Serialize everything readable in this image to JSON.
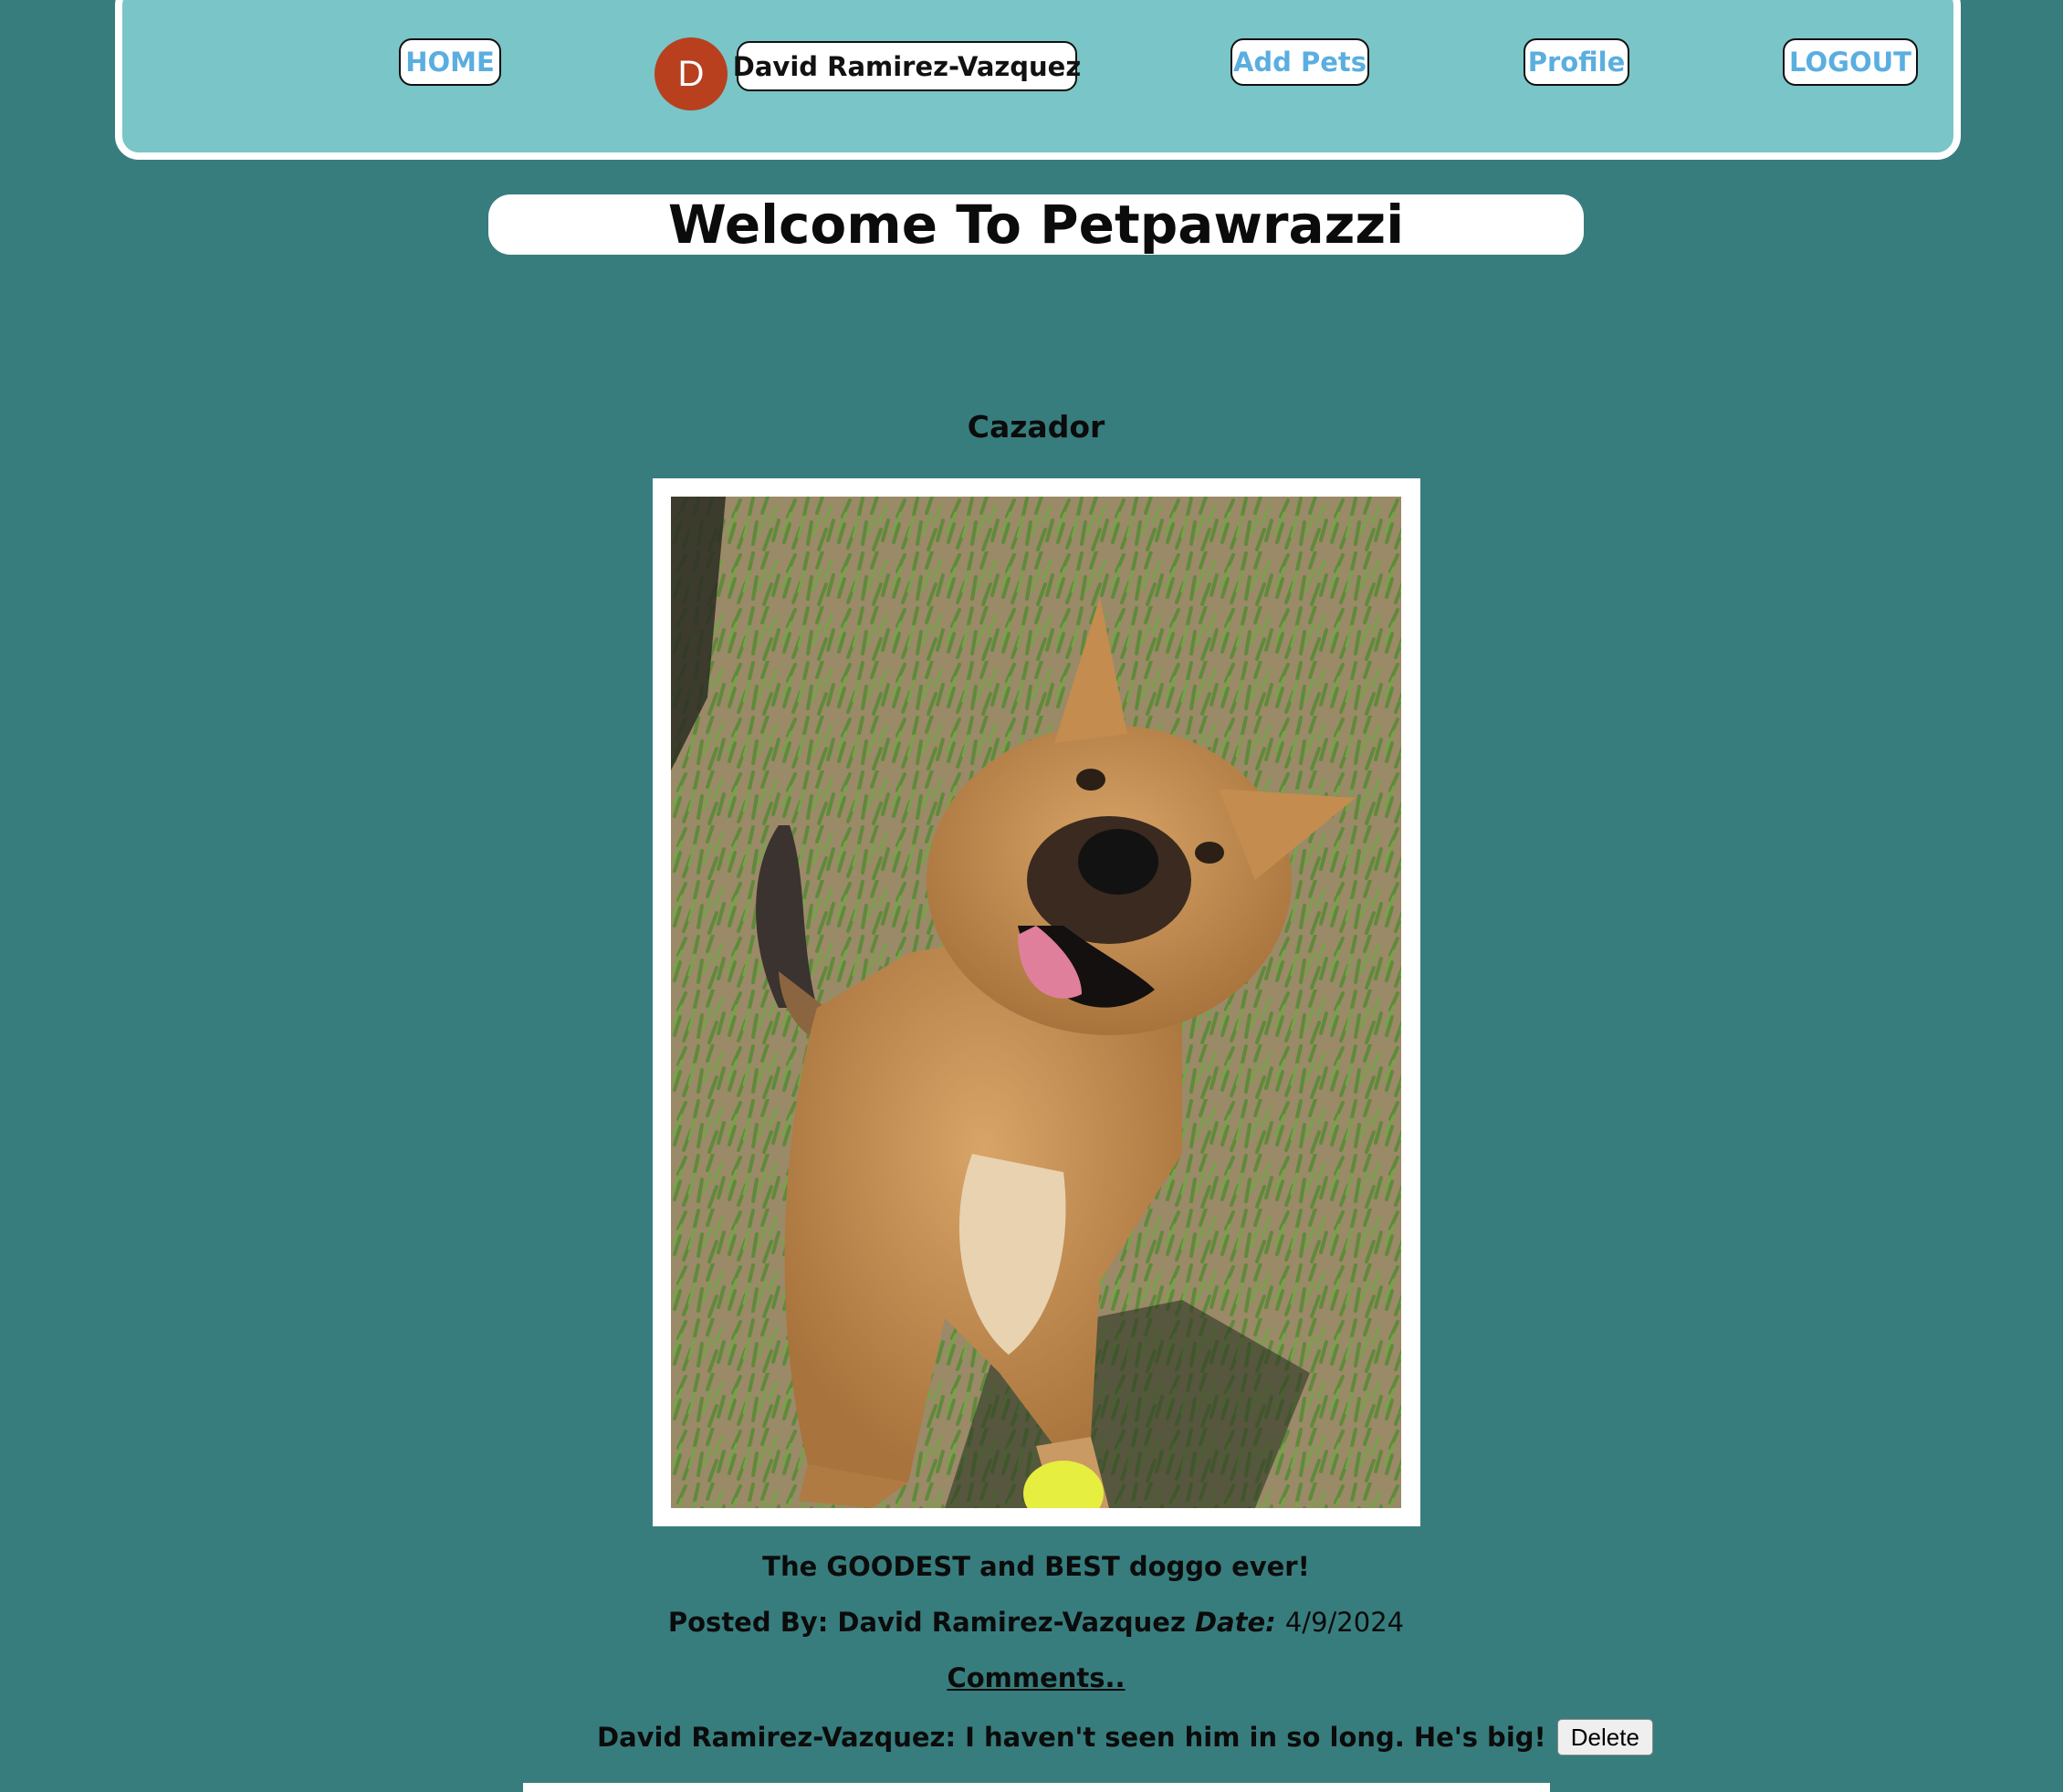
{
  "nav": {
    "home_label": "HOME",
    "avatar_initial": "D",
    "username": "David Ramirez-Vazquez",
    "add_pets_label": "Add Pets",
    "profile_label": "Profile",
    "logout_label": "LOGOUT"
  },
  "welcome": {
    "title": "Welcome To Petpawrazzi"
  },
  "post": {
    "pet_name": "Cazador",
    "description": "The GOODEST and BEST doggo ever!",
    "posted_by_label": "Posted By:",
    "posted_by": "David Ramirez-Vazquez",
    "date_label": "Date:",
    "date": "4/9/2024",
    "comments_link": "Comments..",
    "comments": [
      {
        "author": "David Ramirez-Vazquez",
        "text": "I haven't seen him in so long. He's big!",
        "delete_label": "Delete"
      }
    ]
  },
  "colors": {
    "page_background": "#387d7e",
    "navbar_background": "#79c5c7",
    "nav_link": "#5aaee0",
    "avatar": "#b8401f"
  }
}
